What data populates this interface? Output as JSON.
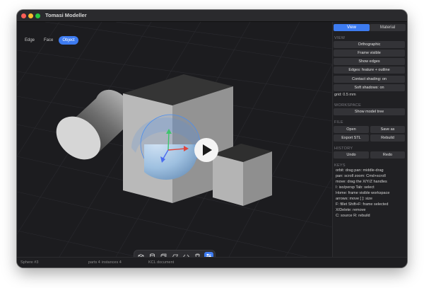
{
  "window": {
    "title": "Tomasi Modeller"
  },
  "viewport": {
    "mode_tabs": [
      "Edge",
      "Face",
      "Object"
    ],
    "active_mode": "Object",
    "selection_color": "#4a8ef0"
  },
  "toolbar": {
    "tools": [
      "box-icon",
      "cylinder-icon",
      "cube-outline-icon",
      "plane-icon",
      "code-icon",
      "trash-icon",
      "sliders-icon"
    ],
    "active_tool": "sliders-icon"
  },
  "status": {
    "selection": "Sphere #3",
    "parts": "parts 4",
    "instances": "instances 4",
    "document": "KCL document"
  },
  "sidebar": {
    "tabs": [
      "View",
      "Material"
    ],
    "active_tab": "View",
    "view": {
      "header": "VIEW",
      "buttons": [
        "Orthographic",
        "Frame visible",
        "Show edges",
        "Edges: feature + outline",
        "Contact shading: on",
        "Soft shadows: on"
      ],
      "grid": "grid: 0.5 mm"
    },
    "workspace": {
      "header": "WORKSPACE",
      "button": "Show model tree"
    },
    "file": {
      "header": "FILE",
      "open": "Open",
      "save_as": "Save as",
      "export_stl": "Export STL",
      "rebuild": "Rebuild"
    },
    "history": {
      "header": "HISTORY",
      "undo": "Undo",
      "redo": "Redo"
    },
    "keys": {
      "header": "KEYS",
      "lines": [
        "orbit: drag    pan: middle-drag",
        "pan: scroll    zoom: Cmd+scroll",
        "move: drag the X/Y/Z handles",
        "I: iso/persp    Tab: select",
        "Home: frame visible workspace",
        "arrows: move    [ ]: size",
        "F: fillet    Shift+F: frame selected",
        "X/Delete: remove",
        "C: source    R: rebuild"
      ]
    }
  }
}
